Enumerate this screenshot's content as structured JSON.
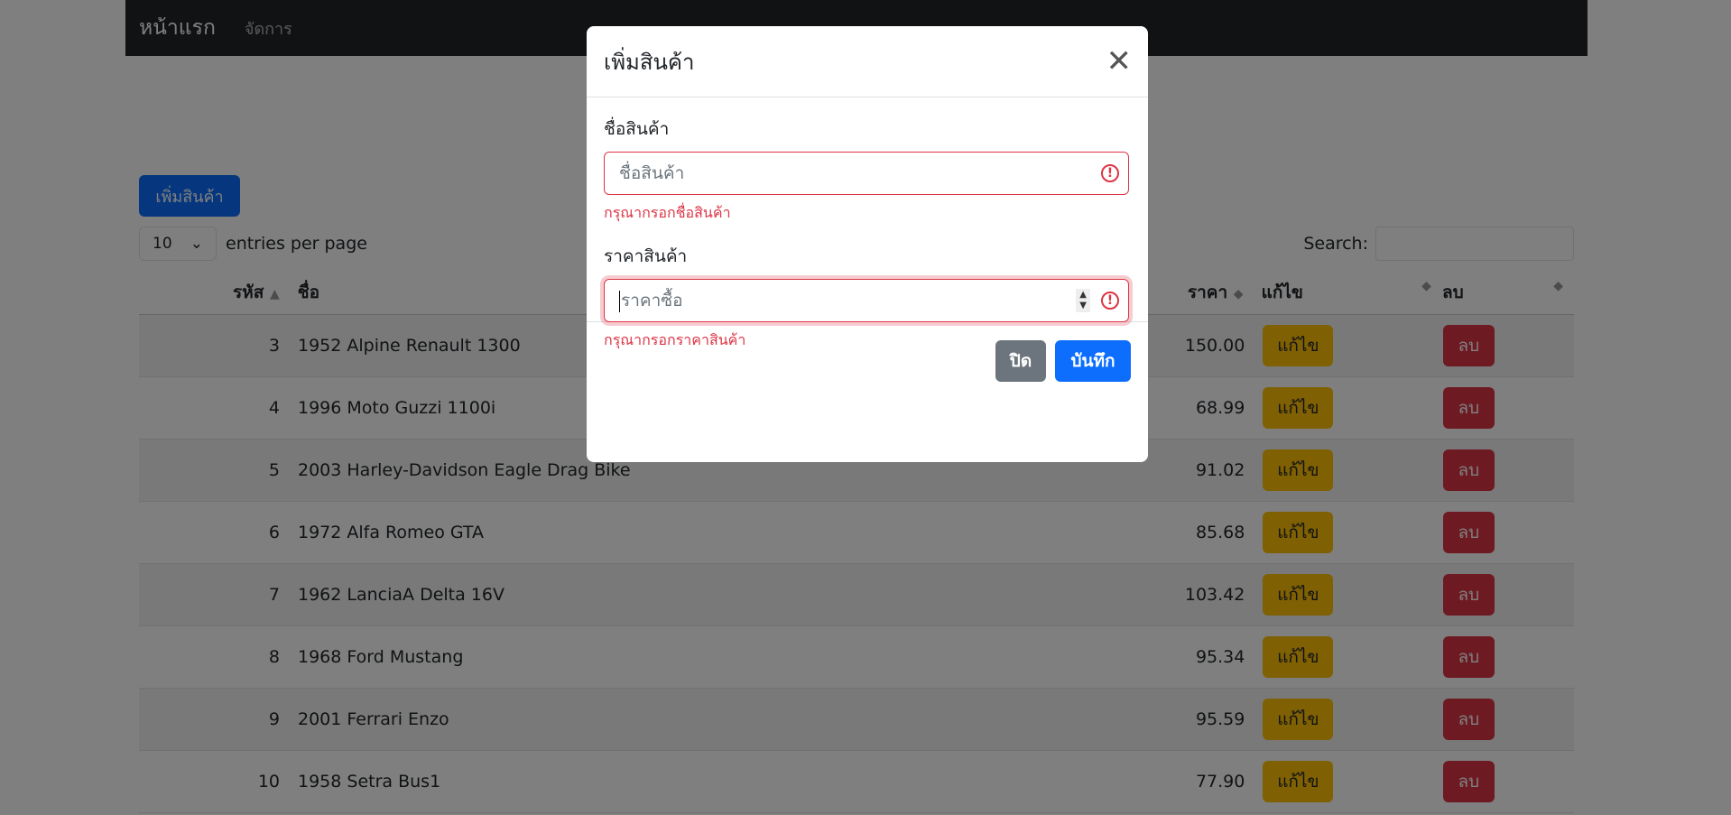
{
  "navbar": {
    "brand": "หน้าแรก",
    "manage": "จัดการ"
  },
  "toolbar": {
    "add_label": "เพิ่มสินค้า"
  },
  "length": {
    "value": "10",
    "label": "entries per page"
  },
  "search": {
    "label": "Search:"
  },
  "table": {
    "columns": {
      "id": "รหัส",
      "name": "ชื่อ",
      "price": "ราคา",
      "edit": "แก้ไข",
      "delete": "ลบ"
    },
    "rows": [
      {
        "id": "3",
        "name": "1952 Alpine Renault 1300",
        "price": "150.00",
        "edit": "แก้ไข",
        "delete": "ลบ"
      },
      {
        "id": "4",
        "name": "1996 Moto Guzzi 1100i",
        "price": "68.99",
        "edit": "แก้ไข",
        "delete": "ลบ"
      },
      {
        "id": "5",
        "name": "2003 Harley-Davidson Eagle Drag Bike",
        "price": "91.02",
        "edit": "แก้ไข",
        "delete": "ลบ"
      },
      {
        "id": "6",
        "name": "1972 Alfa Romeo GTA",
        "price": "85.68",
        "edit": "แก้ไข",
        "delete": "ลบ"
      },
      {
        "id": "7",
        "name": "1962 LanciaA Delta 16V",
        "price": "103.42",
        "edit": "แก้ไข",
        "delete": "ลบ"
      },
      {
        "id": "8",
        "name": "1968 Ford Mustang",
        "price": "95.34",
        "edit": "แก้ไข",
        "delete": "ลบ"
      },
      {
        "id": "9",
        "name": "2001 Ferrari Enzo",
        "price": "95.59",
        "edit": "แก้ไข",
        "delete": "ลบ"
      },
      {
        "id": "10",
        "name": "1958 Setra Bus1",
        "price": "77.90",
        "edit": "แก้ไข",
        "delete": "ลบ"
      }
    ]
  },
  "modal": {
    "title": "เพิ่มสินค้า",
    "name_label": "ชื่อสินค้า",
    "name_placeholder": "ชื่อสินค้า",
    "name_error": "กรุณากรอกชื่อสินค้า",
    "price_label": "ราคาสินค้า",
    "price_placeholder": "ราคาซื้อ",
    "price_error": "กรุณากรอกราคาสินค้า",
    "close_label": "ปิด",
    "save_label": "บันทึก"
  },
  "colors": {
    "primary": "#0d6efd",
    "warning": "#ffc107",
    "danger": "#dc3545",
    "secondary": "#6c757d",
    "navbar": "#212529"
  }
}
